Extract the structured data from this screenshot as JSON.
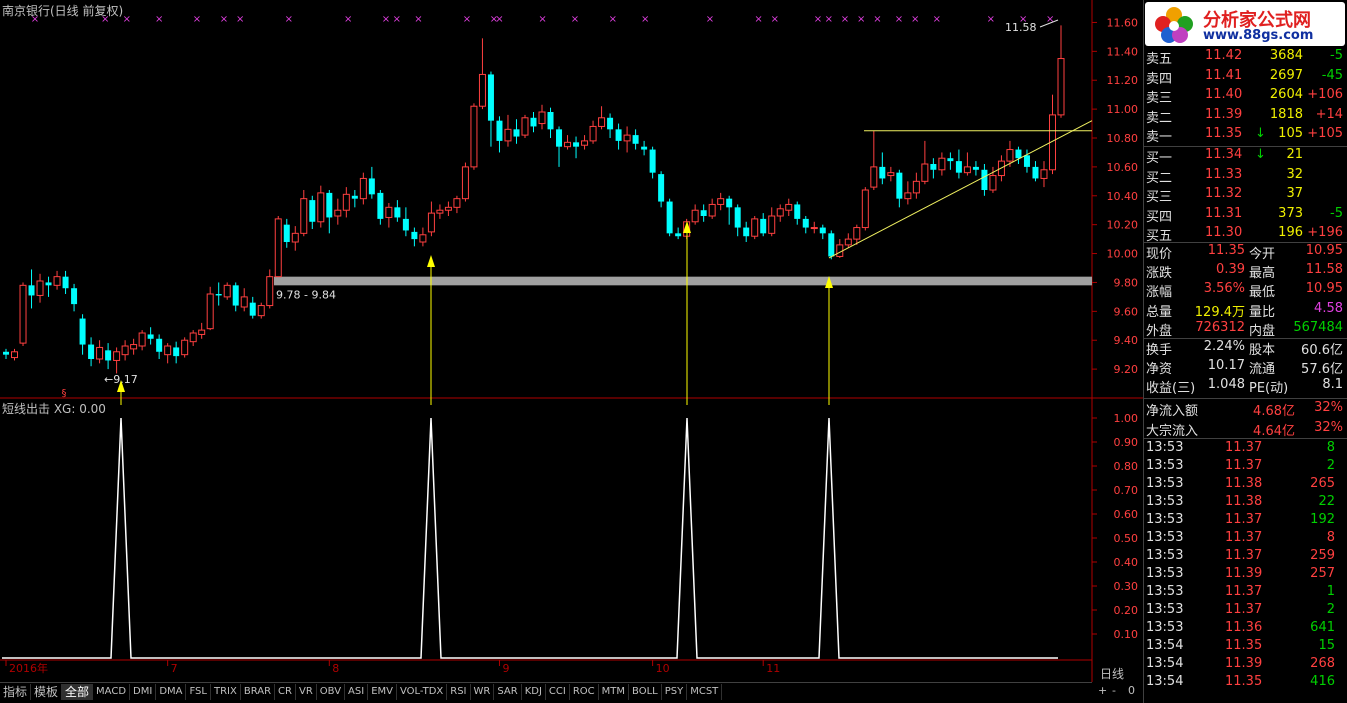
{
  "window_title": "南京银行(日线 前复权)",
  "indicator_title": "短线出击  XG: 0.00",
  "chart_data": {
    "type": "candlestick",
    "price_axis": {
      "min": 9.0,
      "max": 11.7,
      "ticks": [
        "11.60",
        "11.40",
        "11.20",
        "11.00",
        "10.80",
        "10.60",
        "10.40",
        "10.20",
        "10.00",
        "9.80",
        "9.60",
        "9.40",
        "9.20"
      ]
    },
    "indicator_axis": {
      "min": 0,
      "max": 1.0,
      "ticks": [
        "1.00",
        "0.90",
        "0.80",
        "0.70",
        "0.60",
        "0.50",
        "0.40",
        "0.30",
        "0.20",
        "0.10"
      ]
    },
    "month_labels": [
      {
        "label": "2016年",
        "index": 0
      },
      {
        "label": "7",
        "index": 19
      },
      {
        "label": "8",
        "index": 37
      },
      {
        "label": "9",
        "index": 56
      },
      {
        "label": "10",
        "index": 73
      },
      {
        "label": "11",
        "index": 86
      }
    ],
    "candles": [
      [
        9.32,
        9.3,
        9.34,
        9.27
      ],
      [
        9.28,
        9.32,
        9.34,
        9.26
      ],
      [
        9.38,
        9.78,
        9.8,
        9.36
      ],
      [
        9.78,
        9.71,
        9.89,
        9.62
      ],
      [
        9.71,
        9.81,
        9.86,
        9.66
      ],
      [
        9.8,
        9.78,
        9.84,
        9.7
      ],
      [
        9.78,
        9.84,
        9.88,
        9.75
      ],
      [
        9.84,
        9.76,
        9.88,
        9.72
      ],
      [
        9.76,
        9.65,
        9.79,
        9.6
      ],
      [
        9.55,
        9.37,
        9.58,
        9.3
      ],
      [
        9.37,
        9.27,
        9.42,
        9.22
      ],
      [
        9.27,
        9.35,
        9.4,
        9.24
      ],
      [
        9.33,
        9.26,
        9.38,
        9.2
      ],
      [
        9.26,
        9.32,
        9.35,
        9.17
      ],
      [
        9.3,
        9.36,
        9.4,
        9.26
      ],
      [
        9.34,
        9.37,
        9.41,
        9.3
      ],
      [
        9.36,
        9.45,
        9.47,
        9.33
      ],
      [
        9.44,
        9.41,
        9.49,
        9.37
      ],
      [
        9.41,
        9.32,
        9.44,
        9.27
      ],
      [
        9.3,
        9.36,
        9.38,
        9.24
      ],
      [
        9.35,
        9.29,
        9.39,
        9.24
      ],
      [
        9.3,
        9.4,
        9.42,
        9.28
      ],
      [
        9.39,
        9.45,
        9.47,
        9.36
      ],
      [
        9.44,
        9.47,
        9.52,
        9.41
      ],
      [
        9.48,
        9.72,
        9.77,
        9.47
      ],
      [
        9.72,
        9.71,
        9.8,
        9.64
      ],
      [
        9.7,
        9.78,
        9.8,
        9.68
      ],
      [
        9.78,
        9.64,
        9.8,
        9.6
      ],
      [
        9.63,
        9.7,
        9.76,
        9.6
      ],
      [
        9.66,
        9.57,
        9.7,
        9.55
      ],
      [
        9.57,
        9.64,
        9.66,
        9.55
      ],
      [
        9.64,
        9.84,
        9.89,
        9.62
      ],
      [
        9.84,
        10.24,
        10.26,
        9.84
      ],
      [
        10.2,
        10.08,
        10.24,
        10.04
      ],
      [
        10.08,
        10.14,
        10.19,
        10.02
      ],
      [
        10.14,
        10.38,
        10.44,
        10.12
      ],
      [
        10.37,
        10.22,
        10.4,
        10.17
      ],
      [
        10.22,
        10.42,
        10.47,
        10.18
      ],
      [
        10.42,
        10.25,
        10.44,
        10.14
      ],
      [
        10.26,
        10.3,
        10.38,
        10.2
      ],
      [
        10.3,
        10.41,
        10.46,
        10.25
      ],
      [
        10.4,
        10.38,
        10.44,
        10.32
      ],
      [
        10.38,
        10.52,
        10.56,
        10.34
      ],
      [
        10.52,
        10.41,
        10.6,
        10.38
      ],
      [
        10.42,
        10.24,
        10.44,
        10.2
      ],
      [
        10.25,
        10.32,
        10.35,
        10.18
      ],
      [
        10.32,
        10.25,
        10.37,
        10.22
      ],
      [
        10.24,
        10.16,
        10.32,
        10.12
      ],
      [
        10.15,
        10.1,
        10.18,
        10.05
      ],
      [
        10.08,
        10.13,
        10.18,
        10.05
      ],
      [
        10.15,
        10.28,
        10.36,
        10.12
      ],
      [
        10.28,
        10.3,
        10.34,
        10.24
      ],
      [
        10.3,
        10.32,
        10.36,
        10.26
      ],
      [
        10.32,
        10.38,
        10.4,
        10.28
      ],
      [
        10.38,
        10.6,
        10.63,
        10.36
      ],
      [
        10.6,
        11.02,
        11.04,
        10.58
      ],
      [
        11.02,
        11.24,
        11.49,
        11.0
      ],
      [
        11.24,
        10.92,
        11.26,
        10.74
      ],
      [
        10.92,
        10.78,
        10.95,
        10.7
      ],
      [
        10.78,
        10.86,
        10.96,
        10.74
      ],
      [
        10.86,
        10.81,
        10.93,
        10.76
      ],
      [
        10.82,
        10.94,
        10.96,
        10.8
      ],
      [
        10.94,
        10.88,
        10.98,
        10.84
      ],
      [
        10.9,
        10.98,
        11.03,
        10.86
      ],
      [
        10.98,
        10.86,
        11.01,
        10.8
      ],
      [
        10.86,
        10.74,
        10.88,
        10.6
      ],
      [
        10.74,
        10.77,
        10.82,
        10.72
      ],
      [
        10.77,
        10.74,
        10.81,
        10.66
      ],
      [
        10.75,
        10.78,
        10.82,
        10.72
      ],
      [
        10.78,
        10.88,
        10.92,
        10.76
      ],
      [
        10.88,
        10.94,
        11.02,
        10.86
      ],
      [
        10.94,
        10.86,
        10.97,
        10.8
      ],
      [
        10.86,
        10.78,
        10.9,
        10.72
      ],
      [
        10.78,
        10.82,
        10.88,
        10.7
      ],
      [
        10.82,
        10.76,
        10.86,
        10.72
      ],
      [
        10.74,
        10.72,
        10.78,
        10.68
      ],
      [
        10.72,
        10.56,
        10.74,
        10.52
      ],
      [
        10.55,
        10.36,
        10.57,
        10.32
      ],
      [
        10.36,
        10.14,
        10.38,
        10.12
      ],
      [
        10.14,
        10.12,
        10.18,
        10.1
      ],
      [
        10.12,
        10.22,
        10.24,
        10.1
      ],
      [
        10.22,
        10.3,
        10.34,
        10.2
      ],
      [
        10.3,
        10.26,
        10.34,
        10.22
      ],
      [
        10.26,
        10.34,
        10.38,
        10.24
      ],
      [
        10.34,
        10.38,
        10.42,
        10.3
      ],
      [
        10.38,
        10.32,
        10.4,
        10.2
      ],
      [
        10.32,
        10.18,
        10.34,
        10.12
      ],
      [
        10.18,
        10.12,
        10.22,
        10.08
      ],
      [
        10.12,
        10.24,
        10.26,
        10.1
      ],
      [
        10.24,
        10.14,
        10.28,
        10.12
      ],
      [
        10.14,
        10.26,
        10.32,
        10.12
      ],
      [
        10.26,
        10.31,
        10.34,
        10.22
      ],
      [
        10.3,
        10.34,
        10.38,
        10.26
      ],
      [
        10.34,
        10.24,
        10.36,
        10.2
      ],
      [
        10.24,
        10.18,
        10.26,
        10.14
      ],
      [
        10.18,
        10.18,
        10.22,
        10.14
      ],
      [
        10.18,
        10.14,
        10.2,
        10.1
      ],
      [
        10.14,
        9.98,
        10.16,
        9.96
      ],
      [
        9.98,
        10.06,
        10.1,
        9.97
      ],
      [
        10.06,
        10.1,
        10.14,
        10.04
      ],
      [
        10.1,
        10.18,
        10.2,
        10.06
      ],
      [
        10.18,
        10.44,
        10.46,
        10.16
      ],
      [
        10.46,
        10.6,
        10.85,
        10.44
      ],
      [
        10.6,
        10.52,
        10.7,
        10.48
      ],
      [
        10.54,
        10.56,
        10.6,
        10.5
      ],
      [
        10.56,
        10.38,
        10.58,
        10.32
      ],
      [
        10.38,
        10.42,
        10.5,
        10.34
      ],
      [
        10.42,
        10.5,
        10.56,
        10.38
      ],
      [
        10.5,
        10.62,
        10.78,
        10.48
      ],
      [
        10.62,
        10.58,
        10.66,
        10.52
      ],
      [
        10.58,
        10.66,
        10.7,
        10.54
      ],
      [
        10.66,
        10.64,
        10.7,
        10.58
      ],
      [
        10.64,
        10.56,
        10.72,
        10.52
      ],
      [
        10.56,
        10.6,
        10.7,
        10.54
      ],
      [
        10.6,
        10.58,
        10.64,
        10.54
      ],
      [
        10.58,
        10.44,
        10.62,
        10.4
      ],
      [
        10.44,
        10.54,
        10.6,
        10.42
      ],
      [
        10.54,
        10.64,
        10.68,
        10.5
      ],
      [
        10.64,
        10.72,
        10.78,
        10.6
      ],
      [
        10.72,
        10.66,
        10.74,
        10.62
      ],
      [
        10.68,
        10.6,
        10.72,
        10.56
      ],
      [
        10.6,
        10.52,
        10.64,
        10.5
      ],
      [
        10.52,
        10.58,
        10.64,
        10.46
      ],
      [
        10.58,
        10.96,
        11.1,
        10.55
      ],
      [
        10.96,
        11.35,
        11.58,
        10.94
      ]
    ],
    "support_band": {
      "low": 9.78,
      "high": 9.84,
      "label": "9.78 - 9.84"
    },
    "low_label": {
      "value": 9.17,
      "text": "9.17"
    },
    "high_label": {
      "value": 11.58,
      "text": "11.58"
    },
    "signal_indices": [
      20,
      70,
      112,
      134
    ],
    "horizontal_line": {
      "value": 10.85,
      "from_index": 146,
      "to_index": 195
    },
    "trend_line": {
      "from_index": 141,
      "from_value": 9.97,
      "to_index": 195,
      "to_value": 10.75
    }
  },
  "tabs_left": [
    "指标",
    "模板"
  ],
  "tabs": [
    "全部",
    "MACD",
    "DMI",
    "DMA",
    "FSL",
    "TRIX",
    "BRAR",
    "CR",
    "VR",
    "OBV",
    "ASI",
    "EMV",
    "VOL-TDX",
    "RSI",
    "WR",
    "SAR",
    "KDJ",
    "CCI",
    "ROC",
    "MTM",
    "BOLL",
    "PSY",
    "MCST"
  ],
  "active_tab": "全部",
  "period": "日线",
  "zoom_in": "+",
  "zoom_out": "-",
  "zoom_value": "0",
  "logo": {
    "main": "分析家公式网",
    "sub": "www.88gs.com"
  },
  "colors": {
    "up": "#ff4040",
    "down": "#00ffff",
    "signal": "#ffff00",
    "band": "#a0a0a0",
    "marker": "#e040e0"
  },
  "order_book": {
    "asks": [
      {
        "label": "卖五",
        "price": "11.42",
        "vol": "3684",
        "chg": "-5",
        "chg_color": "green"
      },
      {
        "label": "卖四",
        "price": "11.41",
        "vol": "2697",
        "chg": "-45",
        "chg_color": "green"
      },
      {
        "label": "卖三",
        "price": "11.40",
        "vol": "2604",
        "chg": "+106",
        "chg_color": "red"
      },
      {
        "label": "卖二",
        "price": "11.39",
        "vol": "1818",
        "chg": "+14",
        "chg_color": "red"
      },
      {
        "label": "卖一",
        "price": "11.35",
        "vol": "105",
        "chg": "+105",
        "chg_color": "red",
        "arrow": "↓"
      }
    ],
    "bids": [
      {
        "label": "买一",
        "price": "11.34",
        "vol": "21",
        "chg": "",
        "arrow": "↓"
      },
      {
        "label": "买二",
        "price": "11.33",
        "vol": "32",
        "chg": ""
      },
      {
        "label": "买三",
        "price": "11.32",
        "vol": "37",
        "chg": ""
      },
      {
        "label": "买四",
        "price": "11.31",
        "vol": "373",
        "chg": "-5",
        "chg_color": "green"
      },
      {
        "label": "买五",
        "price": "11.30",
        "vol": "196",
        "chg": "+196",
        "chg_color": "red"
      }
    ]
  },
  "stats": [
    {
      "l1": "现价",
      "v1": "11.35",
      "c1": "red",
      "l2": "今开",
      "v2": "10.95",
      "c2": "red"
    },
    {
      "l1": "涨跌",
      "v1": "0.39",
      "c1": "red",
      "l2": "最高",
      "v2": "11.58",
      "c2": "red"
    },
    {
      "l1": "涨幅",
      "v1": "3.56%",
      "c1": "red",
      "l2": "最低",
      "v2": "10.95",
      "c2": "red"
    },
    {
      "l1": "总量",
      "v1": "129.4万",
      "c1": "yellow",
      "l2": "量比",
      "v2": "4.58",
      "c2": "purple"
    },
    {
      "l1": "外盘",
      "v1": "726312",
      "c1": "red",
      "l2": "内盘",
      "v2": "567484",
      "c2": "green"
    },
    {
      "l1": "换手",
      "v1": "2.24%",
      "c1": "white",
      "l2": "股本",
      "v2": "60.6亿",
      "c2": "white"
    },
    {
      "l1": "净资",
      "v1": "10.17",
      "c1": "white",
      "l2": "流通",
      "v2": "57.6亿",
      "c2": "white"
    },
    {
      "l1": "收益(三)",
      "v1": "1.048",
      "c1": "white",
      "l2": "PE(动)",
      "v2": "8.1",
      "c2": "white"
    }
  ],
  "flows": [
    {
      "label": "净流入额",
      "value": "4.68亿",
      "pct": "32%"
    },
    {
      "label": "大宗流入",
      "value": "4.64亿",
      "pct": "32%"
    }
  ],
  "ticks": [
    {
      "t": "13:53",
      "p": "11.37",
      "v": "8",
      "c": "green"
    },
    {
      "t": "13:53",
      "p": "11.37",
      "v": "2",
      "c": "green"
    },
    {
      "t": "13:53",
      "p": "11.38",
      "v": "265",
      "c": "red"
    },
    {
      "t": "13:53",
      "p": "11.38",
      "v": "22",
      "c": "green"
    },
    {
      "t": "13:53",
      "p": "11.37",
      "v": "192",
      "c": "green"
    },
    {
      "t": "13:53",
      "p": "11.37",
      "v": "8",
      "c": "red"
    },
    {
      "t": "13:53",
      "p": "11.37",
      "v": "259",
      "c": "red"
    },
    {
      "t": "13:53",
      "p": "11.39",
      "v": "257",
      "c": "red"
    },
    {
      "t": "13:53",
      "p": "11.37",
      "v": "1",
      "c": "green"
    },
    {
      "t": "13:53",
      "p": "11.37",
      "v": "2",
      "c": "green"
    },
    {
      "t": "13:53",
      "p": "11.36",
      "v": "641",
      "c": "green"
    },
    {
      "t": "13:54",
      "p": "11.35",
      "v": "15",
      "c": "green"
    },
    {
      "t": "13:54",
      "p": "11.39",
      "v": "268",
      "c": "red"
    },
    {
      "t": "13:54",
      "p": "11.35",
      "v": "416",
      "c": "green"
    }
  ]
}
